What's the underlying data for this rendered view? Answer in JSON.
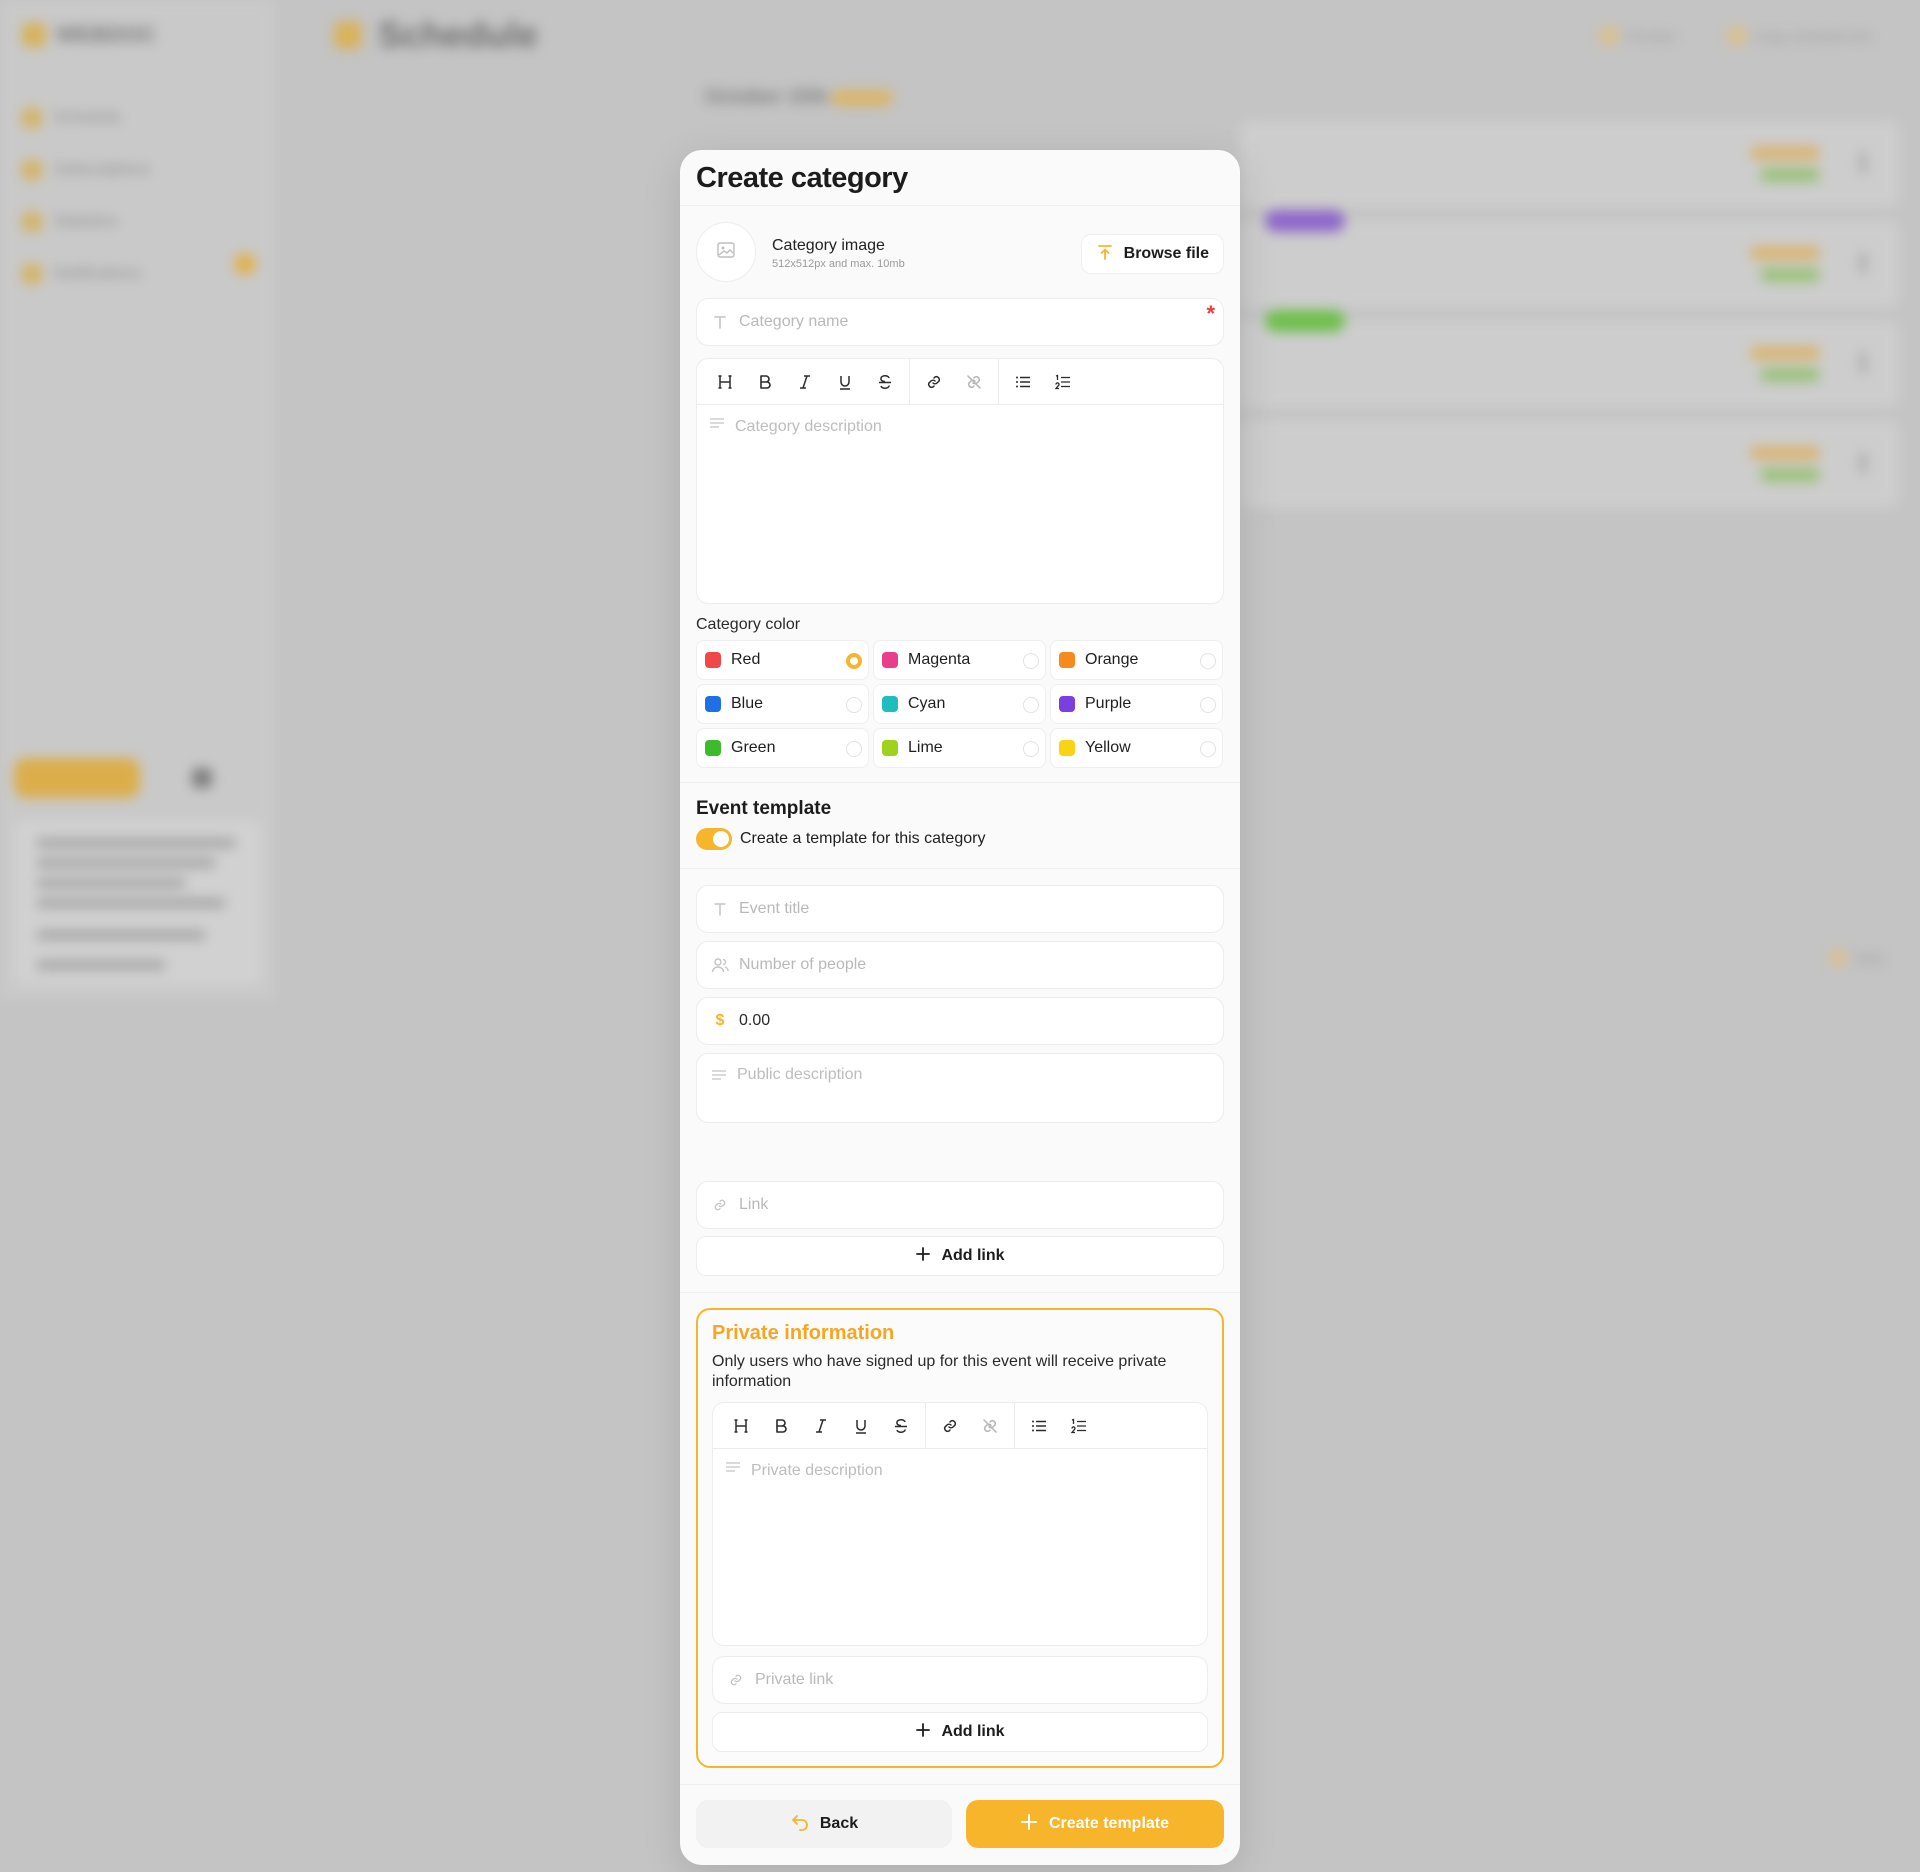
{
  "background": {
    "app_name": "WEBDOC",
    "page_title": "Schedule",
    "nav": [
      "Schedule",
      "Subscriptions",
      "Statistics",
      "Notifications"
    ],
    "top_actions": [
      "Preview",
      "Copy schedule link"
    ],
    "date_label": "October 15th",
    "date_tag": "Today",
    "side_note": "New"
  },
  "modal": {
    "title": "Create category",
    "image": {
      "label": "Category image",
      "hint": "512x512px and max. 10mb",
      "browse_label": "Browse file"
    },
    "name_field": {
      "placeholder": "Category name",
      "required_mark": "*"
    },
    "description_placeholder": "Category description",
    "color_section_label": "Category color",
    "colors": [
      {
        "name": "Red",
        "hex": "#f04848",
        "selected": true
      },
      {
        "name": "Magenta",
        "hex": "#e83e8c",
        "selected": false
      },
      {
        "name": "Orange",
        "hex": "#f78a1e",
        "selected": false
      },
      {
        "name": "Blue",
        "hex": "#1f6fe5",
        "selected": false
      },
      {
        "name": "Cyan",
        "hex": "#1fbdbd",
        "selected": false
      },
      {
        "name": "Purple",
        "hex": "#7b3fe0",
        "selected": false
      },
      {
        "name": "Green",
        "hex": "#3dbb2c",
        "selected": false
      },
      {
        "name": "Lime",
        "hex": "#9ed21c",
        "selected": false
      },
      {
        "name": "Yellow",
        "hex": "#f9d414",
        "selected": false
      }
    ],
    "event_template": {
      "title": "Event template",
      "toggle_label": "Create a template for this category",
      "toggle_on": true,
      "event_title_placeholder": "Event title",
      "people_placeholder": "Number of people",
      "price_value": "0.00",
      "public_desc_placeholder": "Public description",
      "link_placeholder": "Link",
      "add_link_label": "Add link"
    },
    "private": {
      "title": "Private information",
      "description": "Only users who have signed up for this event will receive private information",
      "desc_placeholder": "Private description",
      "link_placeholder": "Private link",
      "add_link_label": "Add link"
    },
    "footer": {
      "back_label": "Back",
      "create_label": "Create template"
    }
  },
  "colors": {
    "accent": "#f7b52c",
    "private_title": "#f5a623",
    "required": "#ef3b3b"
  }
}
